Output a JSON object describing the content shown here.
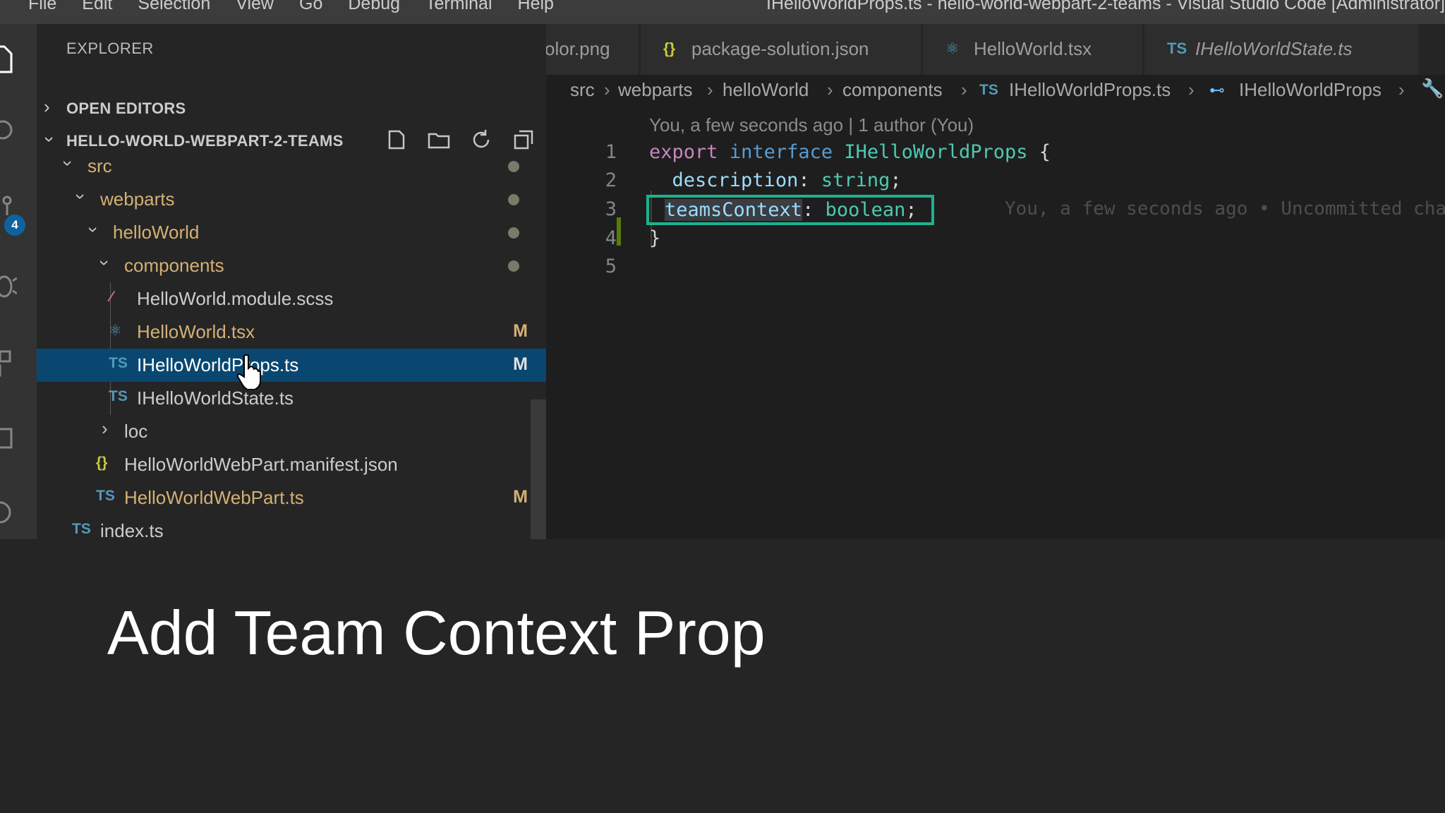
{
  "menu": [
    "File",
    "Edit",
    "Selection",
    "View",
    "Go",
    "Debug",
    "Terminal",
    "Help"
  ],
  "window_title": "IHelloWorldProps.ts - hello-world-webpart-2-teams - Visual Studio Code [Administrator]",
  "activity_bar": {
    "source_control_badge": "4"
  },
  "sidebar": {
    "title": "EXPLORER",
    "open_editors": "OPEN EDITORS",
    "workspace": "HELLO-WORLD-WEBPART-2-TEAMS",
    "tree": [
      {
        "name": "src",
        "type": "folder",
        "status": "dot"
      },
      {
        "name": "webparts",
        "type": "folder",
        "status": "dot"
      },
      {
        "name": "helloWorld",
        "type": "folder",
        "status": "dot"
      },
      {
        "name": "components",
        "type": "folder",
        "status": "dot"
      },
      {
        "name": "HelloWorld.module.scss",
        "type": "scss",
        "status": ""
      },
      {
        "name": "HelloWorld.tsx",
        "type": "tsx",
        "status": "M"
      },
      {
        "name": "IHelloWorldProps.ts",
        "type": "ts",
        "status": "M",
        "selected": true
      },
      {
        "name": "IHelloWorldState.ts",
        "type": "ts",
        "status": ""
      },
      {
        "name": "loc",
        "type": "folder-collapsed",
        "status": ""
      },
      {
        "name": "HelloWorldWebPart.manifest.json",
        "type": "json",
        "status": ""
      },
      {
        "name": "HelloWorldWebPart.ts",
        "type": "ts",
        "status": "M"
      },
      {
        "name": "index.ts",
        "type": "ts",
        "status": ""
      }
    ]
  },
  "tabs": [
    {
      "label": "olor.png",
      "icon": ""
    },
    {
      "label": "package-solution.json",
      "icon": "{}"
    },
    {
      "label": "HelloWorld.tsx",
      "icon": "react"
    },
    {
      "label": "IHelloWorldState.ts",
      "icon": "TS"
    }
  ],
  "breadcrumb": [
    "src",
    "webparts",
    "helloWorld",
    "components",
    "IHelloWorldProps.ts",
    "IHelloWorldProps"
  ],
  "blame_header": "You, a few seconds ago | 1 author (You)",
  "code": {
    "line_numbers": [
      "1",
      "2",
      "3",
      "4",
      "5"
    ],
    "l1_export": "export",
    "l1_interface": "interface",
    "l1_name": "IHelloWorldProps",
    "l1_brace": "{",
    "l2_prop": "description",
    "l2_colon": ":",
    "l2_type": "string",
    "l2_semi": ";",
    "l3_prop": "teamsContext",
    "l3_colon": ":",
    "l3_type": "boolean",
    "l3_semi": ";",
    "l3_blame": "You, a few seconds ago • Uncommitted changes",
    "l4_brace": "}"
  },
  "caption": "Add Team Context Prop",
  "colors": {
    "accent_highlight": "#1cb28e",
    "selection": "#094771",
    "modified": "#d4b072"
  }
}
